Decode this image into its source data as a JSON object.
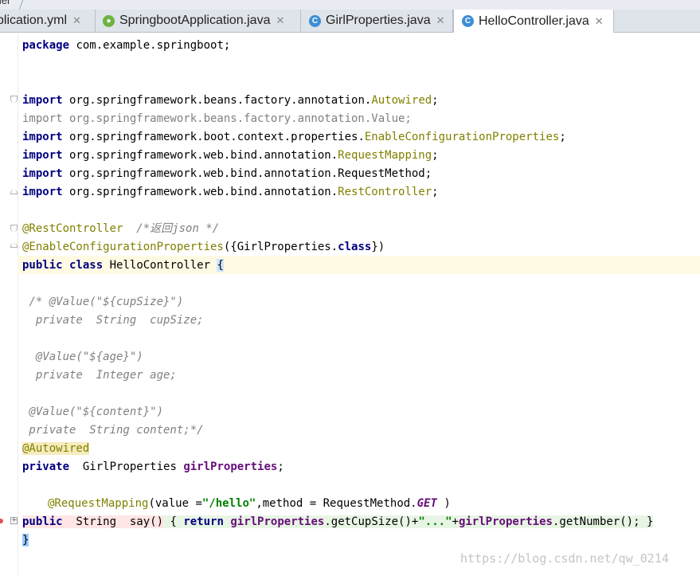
{
  "breadcrumb": "ller",
  "tabs": [
    {
      "label": "plication.yml",
      "icon": "yml-icon",
      "active": false
    },
    {
      "label": "SpringbootApplication.java",
      "icon": "spring-boot-icon",
      "active": false
    },
    {
      "label": "GirlProperties.java",
      "icon": "class-icon",
      "active": false
    },
    {
      "label": "HelloController.java",
      "icon": "class-icon",
      "active": true
    }
  ],
  "close_glyph": "✕",
  "code": {
    "l1": {
      "kw": "package",
      "rest": " com.example.springboot;"
    },
    "imp1": {
      "kw": "import",
      "pkg": " org.springframework.beans.factory.annotation.",
      "cls": "Autowired",
      "end": ";"
    },
    "imp2": {
      "text": "import org.springframework.beans.factory.annotation.Value;"
    },
    "imp3": {
      "kw": "import",
      "pkg": " org.springframework.boot.context.properties.",
      "cls": "EnableConfigurationProperties",
      "end": ";"
    },
    "imp4": {
      "kw": "import",
      "pkg": " org.springframework.web.bind.annotation.",
      "cls": "RequestMapping",
      "end": ";"
    },
    "imp5": {
      "kw": "import",
      "pkg": " org.springframework.web.bind.annotation.RequestMethod;"
    },
    "imp6": {
      "kw": "import",
      "pkg": " org.springframework.web.bind.annotation.",
      "cls": "RestController",
      "end": ";"
    },
    "rc": {
      "ann": "@RestController",
      "cmt": "  /*返回json */"
    },
    "ecp": {
      "ann": "@EnableConfigurationProperties",
      "p1": "({GirlProperties.",
      "kw": "class",
      "p2": "})"
    },
    "cls": {
      "kw1": "public",
      "kw2": "class",
      "name": " HelloController ",
      "brace": "{"
    },
    "c1": " /* @Value(\"${cupSize}\")",
    "c2": "  private  String  cupSize;",
    "c3": "  @Value(\"${age}\")",
    "c4": "  private  Integer age;",
    "c5": " @Value(\"${content}\")",
    "c6": " private  String content;*/",
    "aw": "@Autowired",
    "gp": {
      "kw": "private",
      "type": "  GirlProperties ",
      "field": "girlProperties",
      "end": ";"
    },
    "rm": {
      "ann": "@RequestMapping",
      "p1": "(value =",
      "str": "\"/hello\"",
      "p2": ",method = RequestMethod.",
      "sf": "GET",
      "p3": " )"
    },
    "say": {
      "kw": "public",
      "type": "  String  ",
      "name": "say()",
      "ob": " { ",
      "ret": "return",
      "f1": " girlProperties",
      "m1": ".getCupSize()+",
      "str": "\"...\"",
      "plus": "+",
      "f2": "girlProperties",
      "m2": ".getNumber(); ",
      "cb": "}"
    },
    "close": "}"
  },
  "watermark": "https://blog.csdn.net/qw_0214"
}
